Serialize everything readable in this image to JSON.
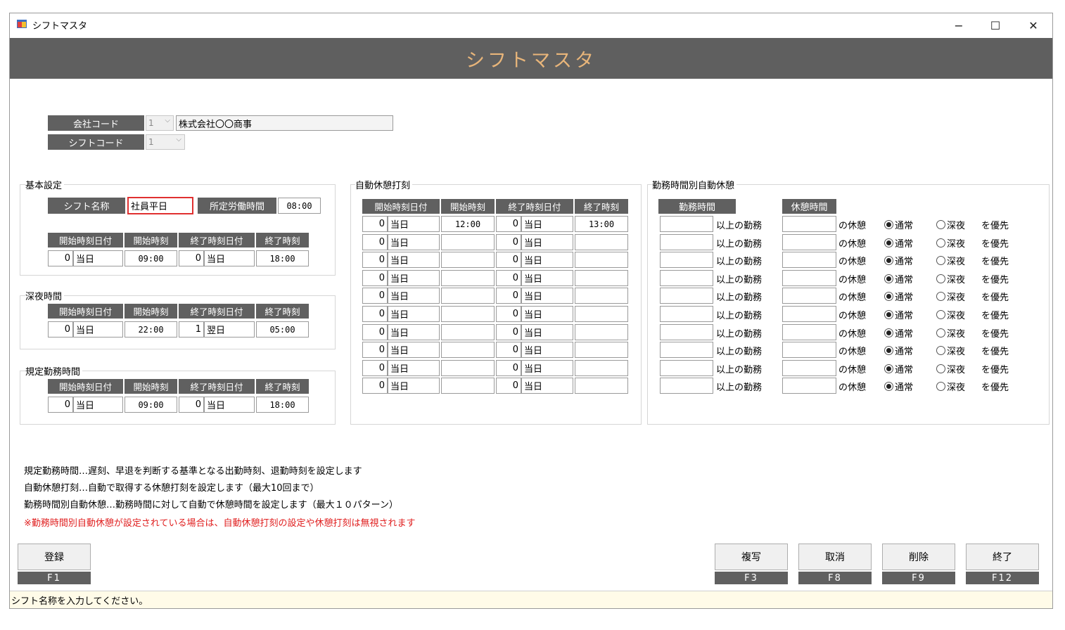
{
  "window": {
    "title": "シフトマスタ",
    "minimize": "−",
    "maximize": "☐",
    "close": "✕"
  },
  "banner": "シフトマスタ",
  "company": {
    "label": "会社コード",
    "code": "1",
    "name": "株式会社〇〇商事"
  },
  "shift_code": {
    "label": "シフトコード",
    "code": "1"
  },
  "basic": {
    "title": "基本設定",
    "name_label": "シフト名称",
    "name_value": "社員平日",
    "hours_label": "所定労働時間",
    "hours_value": "08:00",
    "headers": [
      "開始時刻日付",
      "開始時刻",
      "終了時刻日付",
      "終了時刻"
    ],
    "start_day": "0",
    "start_day_text": "当日",
    "start_time": "09:00",
    "end_day": "0",
    "end_day_text": "当日",
    "end_time": "18:00"
  },
  "night": {
    "title": "深夜時間",
    "headers": [
      "開始時刻日付",
      "開始時刻",
      "終了時刻日付",
      "終了時刻"
    ],
    "start_day": "0",
    "start_day_text": "当日",
    "start_time": "22:00",
    "end_day": "1",
    "end_day_text": "翌日",
    "end_time": "05:00"
  },
  "regular": {
    "title": "規定勤務時間",
    "headers": [
      "開始時刻日付",
      "開始時刻",
      "終了時刻日付",
      "終了時刻"
    ],
    "start_day": "0",
    "start_day_text": "当日",
    "start_time": "09:00",
    "end_day": "0",
    "end_day_text": "当日",
    "end_time": "18:00"
  },
  "auto_break": {
    "title": "自動休憩打刻",
    "headers": [
      "開始時刻日付",
      "開始時刻",
      "終了時刻日付",
      "終了時刻"
    ],
    "rows": [
      {
        "sd": "0",
        "sdt": "当日",
        "st": "12:00",
        "ed": "0",
        "edt": "当日",
        "et": "13:00"
      },
      {
        "sd": "0",
        "sdt": "当日",
        "st": "",
        "ed": "0",
        "edt": "当日",
        "et": ""
      },
      {
        "sd": "0",
        "sdt": "当日",
        "st": "",
        "ed": "0",
        "edt": "当日",
        "et": ""
      },
      {
        "sd": "0",
        "sdt": "当日",
        "st": "",
        "ed": "0",
        "edt": "当日",
        "et": ""
      },
      {
        "sd": "0",
        "sdt": "当日",
        "st": "",
        "ed": "0",
        "edt": "当日",
        "et": ""
      },
      {
        "sd": "0",
        "sdt": "当日",
        "st": "",
        "ed": "0",
        "edt": "当日",
        "et": ""
      },
      {
        "sd": "0",
        "sdt": "当日",
        "st": "",
        "ed": "0",
        "edt": "当日",
        "et": ""
      },
      {
        "sd": "0",
        "sdt": "当日",
        "st": "",
        "ed": "0",
        "edt": "当日",
        "et": ""
      },
      {
        "sd": "0",
        "sdt": "当日",
        "st": "",
        "ed": "0",
        "edt": "当日",
        "et": ""
      },
      {
        "sd": "0",
        "sdt": "当日",
        "st": "",
        "ed": "0",
        "edt": "当日",
        "et": ""
      }
    ]
  },
  "work_break": {
    "title": "勤務時間別自動休憩",
    "work_header": "勤務時間",
    "break_header": "休憩時間",
    "over_text": "以上の勤務",
    "break_text": "の休憩",
    "normal_text": "通常",
    "night_text": "深夜",
    "priority_text": "を優先",
    "rows": [
      {
        "work": "",
        "brk": "",
        "sel": "normal"
      },
      {
        "work": "",
        "brk": "",
        "sel": "normal"
      },
      {
        "work": "",
        "brk": "",
        "sel": "normal"
      },
      {
        "work": "",
        "brk": "",
        "sel": "normal"
      },
      {
        "work": "",
        "brk": "",
        "sel": "normal"
      },
      {
        "work": "",
        "brk": "",
        "sel": "normal"
      },
      {
        "work": "",
        "brk": "",
        "sel": "normal"
      },
      {
        "work": "",
        "brk": "",
        "sel": "normal"
      },
      {
        "work": "",
        "brk": "",
        "sel": "normal"
      },
      {
        "work": "",
        "brk": "",
        "sel": "normal"
      }
    ]
  },
  "notes": [
    "規定勤務時間…遅刻、早退を判断する基準となる出勤時刻、退勤時刻を設定します",
    "自動休憩打刻…自動で取得する休憩打刻を設定します（最大10回まで）",
    "勤務時間別自動休憩…勤務時間に対して自動で休憩時間を設定します（最大１０パターン）"
  ],
  "warning": "※勤務時間別自動休憩が設定されている場合は、自動休憩打刻の設定や休憩打刻は無視されます",
  "colors": {
    "warning": "#e02020",
    "banner_text": "#e8b57a",
    "label_bg": "#606060",
    "focus_border": "#e03030"
  },
  "buttons": {
    "register": {
      "label": "登録",
      "key": "F1"
    },
    "copy": {
      "label": "複写",
      "key": "F3"
    },
    "cancel": {
      "label": "取消",
      "key": "F8"
    },
    "delete": {
      "label": "削除",
      "key": "F9"
    },
    "exit": {
      "label": "終了",
      "key": "F12"
    }
  },
  "status": "シフト名称を入力してください。"
}
